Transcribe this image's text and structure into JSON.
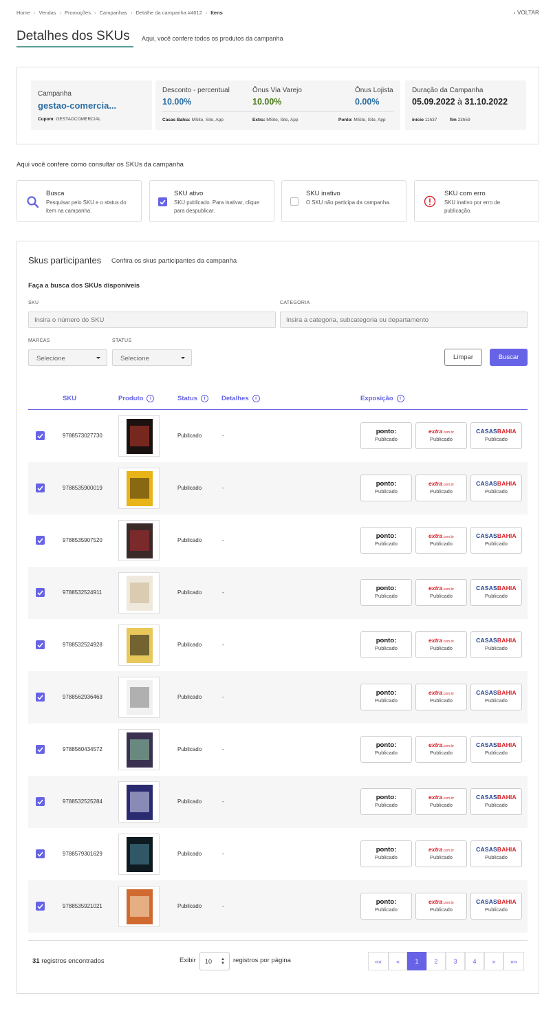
{
  "breadcrumb": [
    "Home",
    "Vendas",
    "Promoções",
    "Campanhas",
    "Detalhe da campanha #4612",
    "Itens"
  ],
  "back_label": "VOLTAR",
  "page": {
    "title": "Detalhes dos SKUs",
    "subtitle": "Aqui, você confere todos os produtos da campanha"
  },
  "campaign": {
    "label": "Campanha",
    "name": "gestao-comercia...",
    "coupon_label": "Cupom:",
    "coupon_value": "GESTAOCOMERCIAL",
    "discount_label": "Desconto - percentual",
    "discount_value": "10.00%",
    "onus_via_label": "Ônus Via Varejo",
    "onus_via_value": "10.00%",
    "onus_lojista_label": "Ônus Lojista",
    "onus_lojista_value": "0.00%",
    "casas_label": "Casas Bahia:",
    "casas_value": "MSite, Site, App",
    "extra_label": "Extra:",
    "extra_value": "MSite, Site, App",
    "ponto_label": "Ponto:",
    "ponto_value": "MSite, Site, App",
    "duration_label": "Duração da Campanha",
    "start_date": "05.09.2022",
    "date_sep": "à",
    "end_date": "31.10.2022",
    "start_label": "início",
    "start_time": "11h37",
    "end_label": "fim",
    "end_time": "23h59"
  },
  "consult_title": "Aqui você confere como consultar os SKUs da campanha",
  "legend": [
    {
      "title": "Busca",
      "desc": "Pesquisar pelo SKU e o status do item na campanha.",
      "icon": "search-icon"
    },
    {
      "title": "SKU ativo",
      "desc": "SKU publicado. Para inativar, clique para despublicar.",
      "icon": "checkbox-checked-icon"
    },
    {
      "title": "SKU inativo",
      "desc": "O SKU não participa da campanha.",
      "icon": "checkbox-empty-icon"
    },
    {
      "title": "SKU com erro",
      "desc": "SKU inativo por erro de publicação.",
      "icon": "error-icon"
    }
  ],
  "skus_section": {
    "title": "Skus participantes",
    "subtitle": "Confira os skus participantes da campanha",
    "search_title": "Faça a busca dos SKUs disponíveis",
    "sku_label": "SKU",
    "sku_placeholder": "Insira o número do SKU",
    "category_label": "CATEGORIA",
    "category_placeholder": "Insira a categoria, subcategoria ou departamento",
    "brands_label": "MARCAS",
    "brands_value": "Selecione",
    "status_label": "STATUS",
    "status_value": "Selecione",
    "clear_label": "Limpar",
    "search_label": "Buscar"
  },
  "table": {
    "headers": {
      "sku": "SKU",
      "product": "Produto",
      "status": "Status",
      "details": "Detalhes",
      "exposure": "Exposição"
    },
    "rows": [
      {
        "sku": "9788573027730",
        "status": "Publicado",
        "details": "-",
        "cover_bg": "#1a1210",
        "cover_fg": "#c43a2a"
      },
      {
        "sku": "9788535900019",
        "status": "Publicado",
        "details": "-",
        "cover_bg": "#e8b418",
        "cover_fg": "#3a2a10"
      },
      {
        "sku": "9788535907520",
        "status": "Publicado",
        "details": "-",
        "cover_bg": "#3a2a28",
        "cover_fg": "#b02a30"
      },
      {
        "sku": "9788532524911",
        "status": "Publicado",
        "details": "-",
        "cover_bg": "#efe9dd",
        "cover_fg": "#c9b48a"
      },
      {
        "sku": "9788532524928",
        "status": "Publicado",
        "details": "-",
        "cover_bg": "#e8c85a",
        "cover_fg": "#111111"
      },
      {
        "sku": "9788562936463",
        "status": "Publicado",
        "details": "-",
        "cover_bg": "#f1f1f1",
        "cover_fg": "#7a7a7a"
      },
      {
        "sku": "9788560434572",
        "status": "Publicado",
        "details": "-",
        "cover_bg": "#3a3050",
        "cover_fg": "#8fd4a8"
      },
      {
        "sku": "9788532525284",
        "status": "Publicado",
        "details": "-",
        "cover_bg": "#2a2a70",
        "cover_fg": "#d8d8f0"
      },
      {
        "sku": "9788579301629",
        "status": "Publicado",
        "details": "-",
        "cover_bg": "#0e1a20",
        "cover_fg": "#4a8aa0"
      },
      {
        "sku": "9788535921021",
        "status": "Publicado",
        "details": "-",
        "cover_bg": "#d06a30",
        "cover_fg": "#f5e6c8"
      }
    ],
    "exposure": {
      "ponto_logo": "ponto:",
      "extra_logo": "extra",
      "extra_suffix": ".com.br",
      "casas_logo_a": "CASAS",
      "casas_logo_b": "BAHIA",
      "status": "Publicado"
    }
  },
  "footer": {
    "records_count": "31",
    "records_label": "registros encontrados",
    "show_label": "Exibir",
    "per_page_value": "10",
    "per_page_label": "registros por página",
    "pagination": [
      "««",
      "«",
      "1",
      "2",
      "3",
      "4",
      "»",
      "»»"
    ],
    "active_page": "1"
  },
  "colors": {
    "accent": "#6663e6",
    "brand_blue": "#2f6fa3",
    "green": "#4a7a1a",
    "teal_line": "#5a9e95"
  }
}
